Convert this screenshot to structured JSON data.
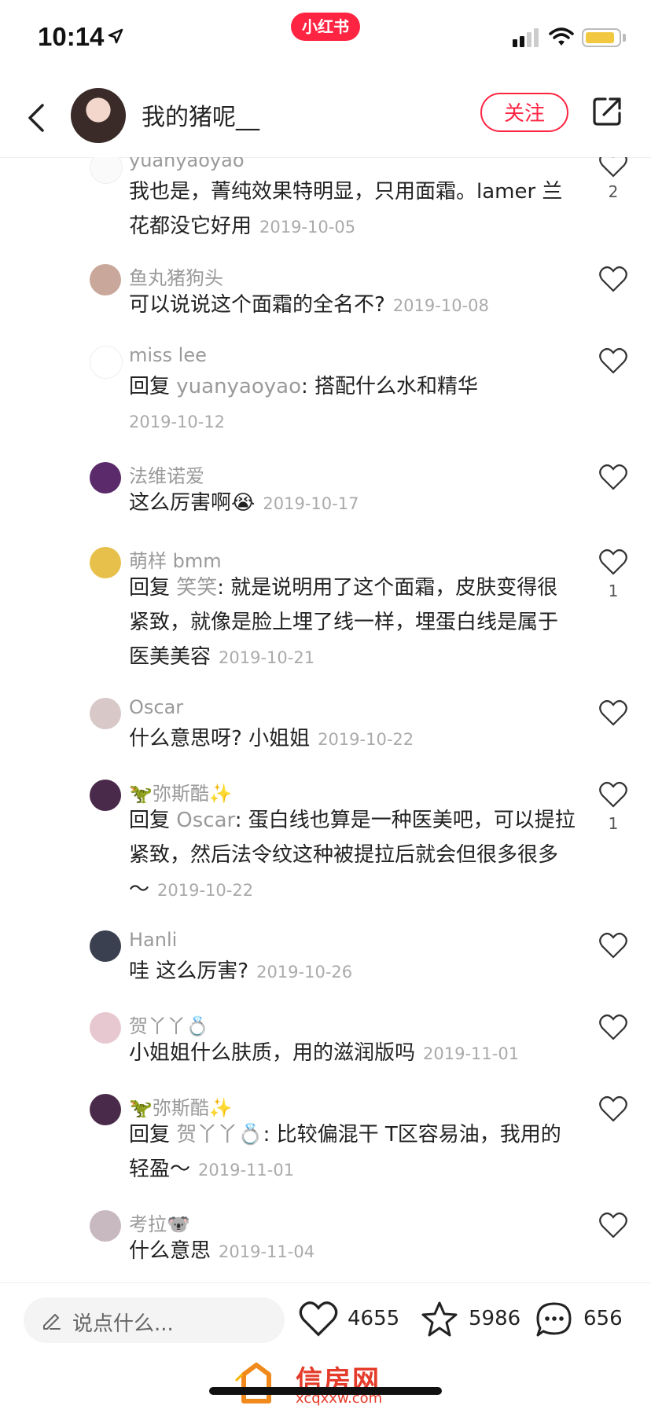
{
  "status_bar": {
    "time": "10:14",
    "app_badge": "小红书"
  },
  "header": {
    "author": "我的猪呢__",
    "follow_label": "关注"
  },
  "comments": [
    {
      "name": "yuanyaoyao",
      "text": "我也是，菁纯效果特明显，只用面霜。lamer 兰花都没它好用",
      "date": "2019-10-05",
      "likes": "2"
    },
    {
      "name": "鱼丸猪狗头",
      "text": "可以说说这个面霜的全名不?",
      "date": "2019-10-08",
      "likes": ""
    },
    {
      "name": "miss lee",
      "reply_prefix": "回复 ",
      "reply_to": "yuanyaoyao",
      "text": ": 搭配什么水和精华",
      "date": "2019-10-12",
      "likes": ""
    },
    {
      "name": "法维诺爱",
      "text": "这么厉害啊😭",
      "date": "2019-10-17",
      "likes": ""
    },
    {
      "name": "萌样 bmm",
      "reply_prefix": "回复 ",
      "reply_to": "笑笑",
      "text": ": 就是说明用了这个面霜，皮肤变得很紧致，就像是脸上埋了线一样，埋蛋白线是属于医美美容",
      "date": "2019-10-21",
      "likes": "1"
    },
    {
      "name": "Oscar",
      "text": "什么意思呀? 小姐姐",
      "date": "2019-10-22",
      "likes": ""
    },
    {
      "name": "🦖弥斯酷✨",
      "reply_prefix": "回复 ",
      "reply_to": "Oscar",
      "text": ": 蛋白线也算是一种医美吧，可以提拉紧致，然后法令纹这种被提拉后就会但很多很多～",
      "date": "2019-10-22",
      "likes": "1"
    },
    {
      "name": "Hanli",
      "text": "哇 这么厉害?",
      "date": "2019-10-26",
      "likes": ""
    },
    {
      "name": "贺丫丫💍",
      "text": "小姐姐什么肤质，用的滋润版吗",
      "date": "2019-11-01",
      "likes": ""
    },
    {
      "name": "🦖弥斯酷✨",
      "reply_prefix": "回复 ",
      "reply_to": "贺丫丫💍",
      "text": ": 比较偏混干 T区容易油，我用的轻盈～",
      "date": "2019-11-01",
      "likes": ""
    },
    {
      "name": "考拉🐨",
      "text": "什么意思",
      "date": "2019-11-04",
      "likes": ""
    }
  ],
  "bottom_bar": {
    "input_placeholder": "说点什么...",
    "likes_count": "4655",
    "favorites_count": "5986",
    "comments_count": "656"
  },
  "watermark": {
    "title": "信房网",
    "url": "xcqxxw.com"
  },
  "colors": {
    "accent": "#ff2442",
    "muted_text": "#9a9a9a",
    "date_text": "#aaaaaa"
  }
}
